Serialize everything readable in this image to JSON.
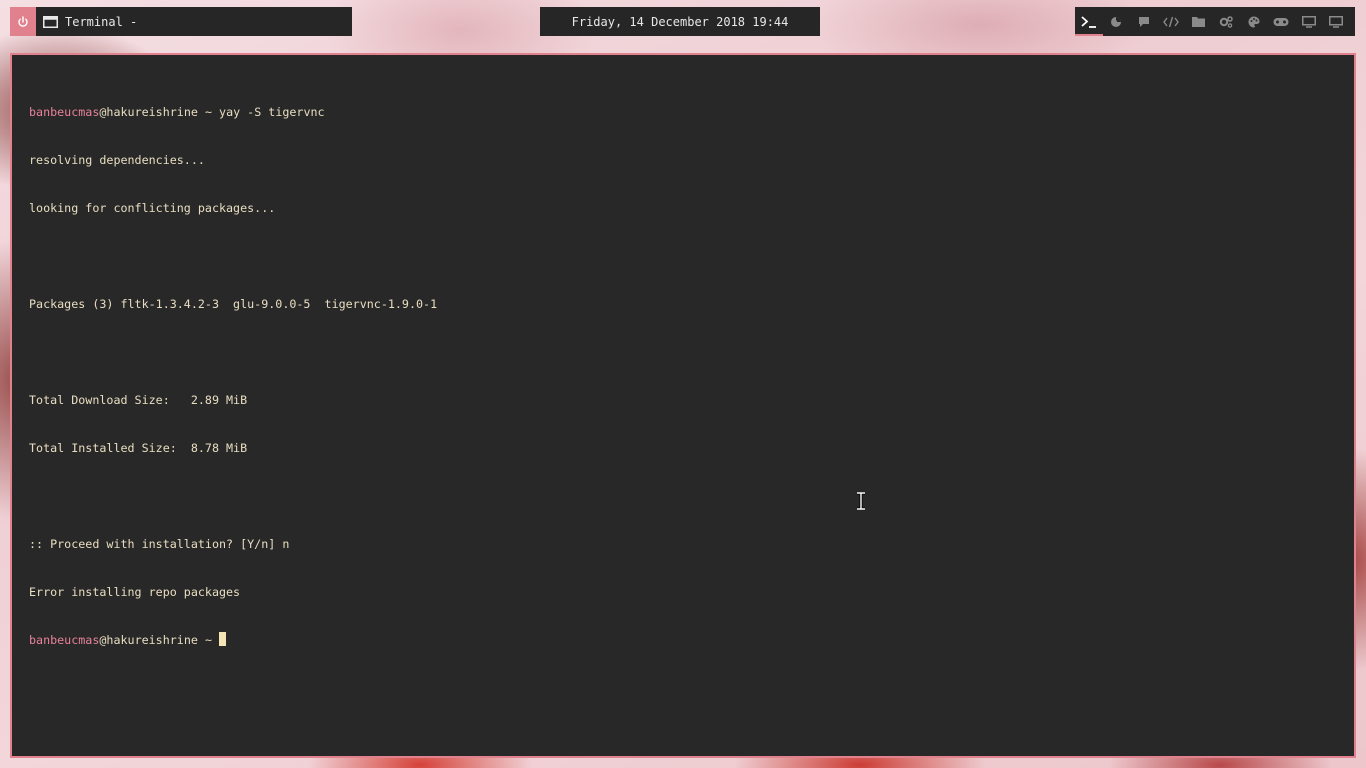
{
  "taskbar": {
    "window_title": "Terminal -",
    "clock": "Friday, 14 December 2018 19:44",
    "workspaces": [
      {
        "icon": "terminal-icon",
        "active": true
      },
      {
        "icon": "firefox-icon",
        "active": false
      },
      {
        "icon": "chat-icon",
        "active": false
      },
      {
        "icon": "code-icon",
        "active": false
      },
      {
        "icon": "folder-icon",
        "active": false
      },
      {
        "icon": "settings-icon",
        "active": false
      },
      {
        "icon": "palette-icon",
        "active": false
      },
      {
        "icon": "gamepad-icon",
        "active": false
      },
      {
        "icon": "monitor-icon",
        "active": false
      },
      {
        "icon": "monitor-icon",
        "active": false
      }
    ],
    "colors": {
      "accent": "#e1818d",
      "panel": "#262626"
    }
  },
  "terminal": {
    "prompt_user": "banbeucmas",
    "prompt_at": "@",
    "prompt_host": "hakureishrine",
    "prompt_tail": " ~ ",
    "command": "yay -S tigervnc",
    "output": [
      "resolving dependencies...",
      "looking for conflicting packages...",
      "",
      "Packages (3) fltk-1.3.4.2-3  glu-9.0.0-5  tigervnc-1.9.0-1",
      "",
      "Total Download Size:   2.89 MiB",
      "Total Installed Size:  8.78 MiB",
      "",
      ":: Proceed with installation? [Y/n] n",
      "Error installing repo packages"
    ],
    "colors": {
      "background": "#282828",
      "text": "#e8ddc0",
      "user": "#e7829b",
      "border": "#e1818d"
    }
  }
}
